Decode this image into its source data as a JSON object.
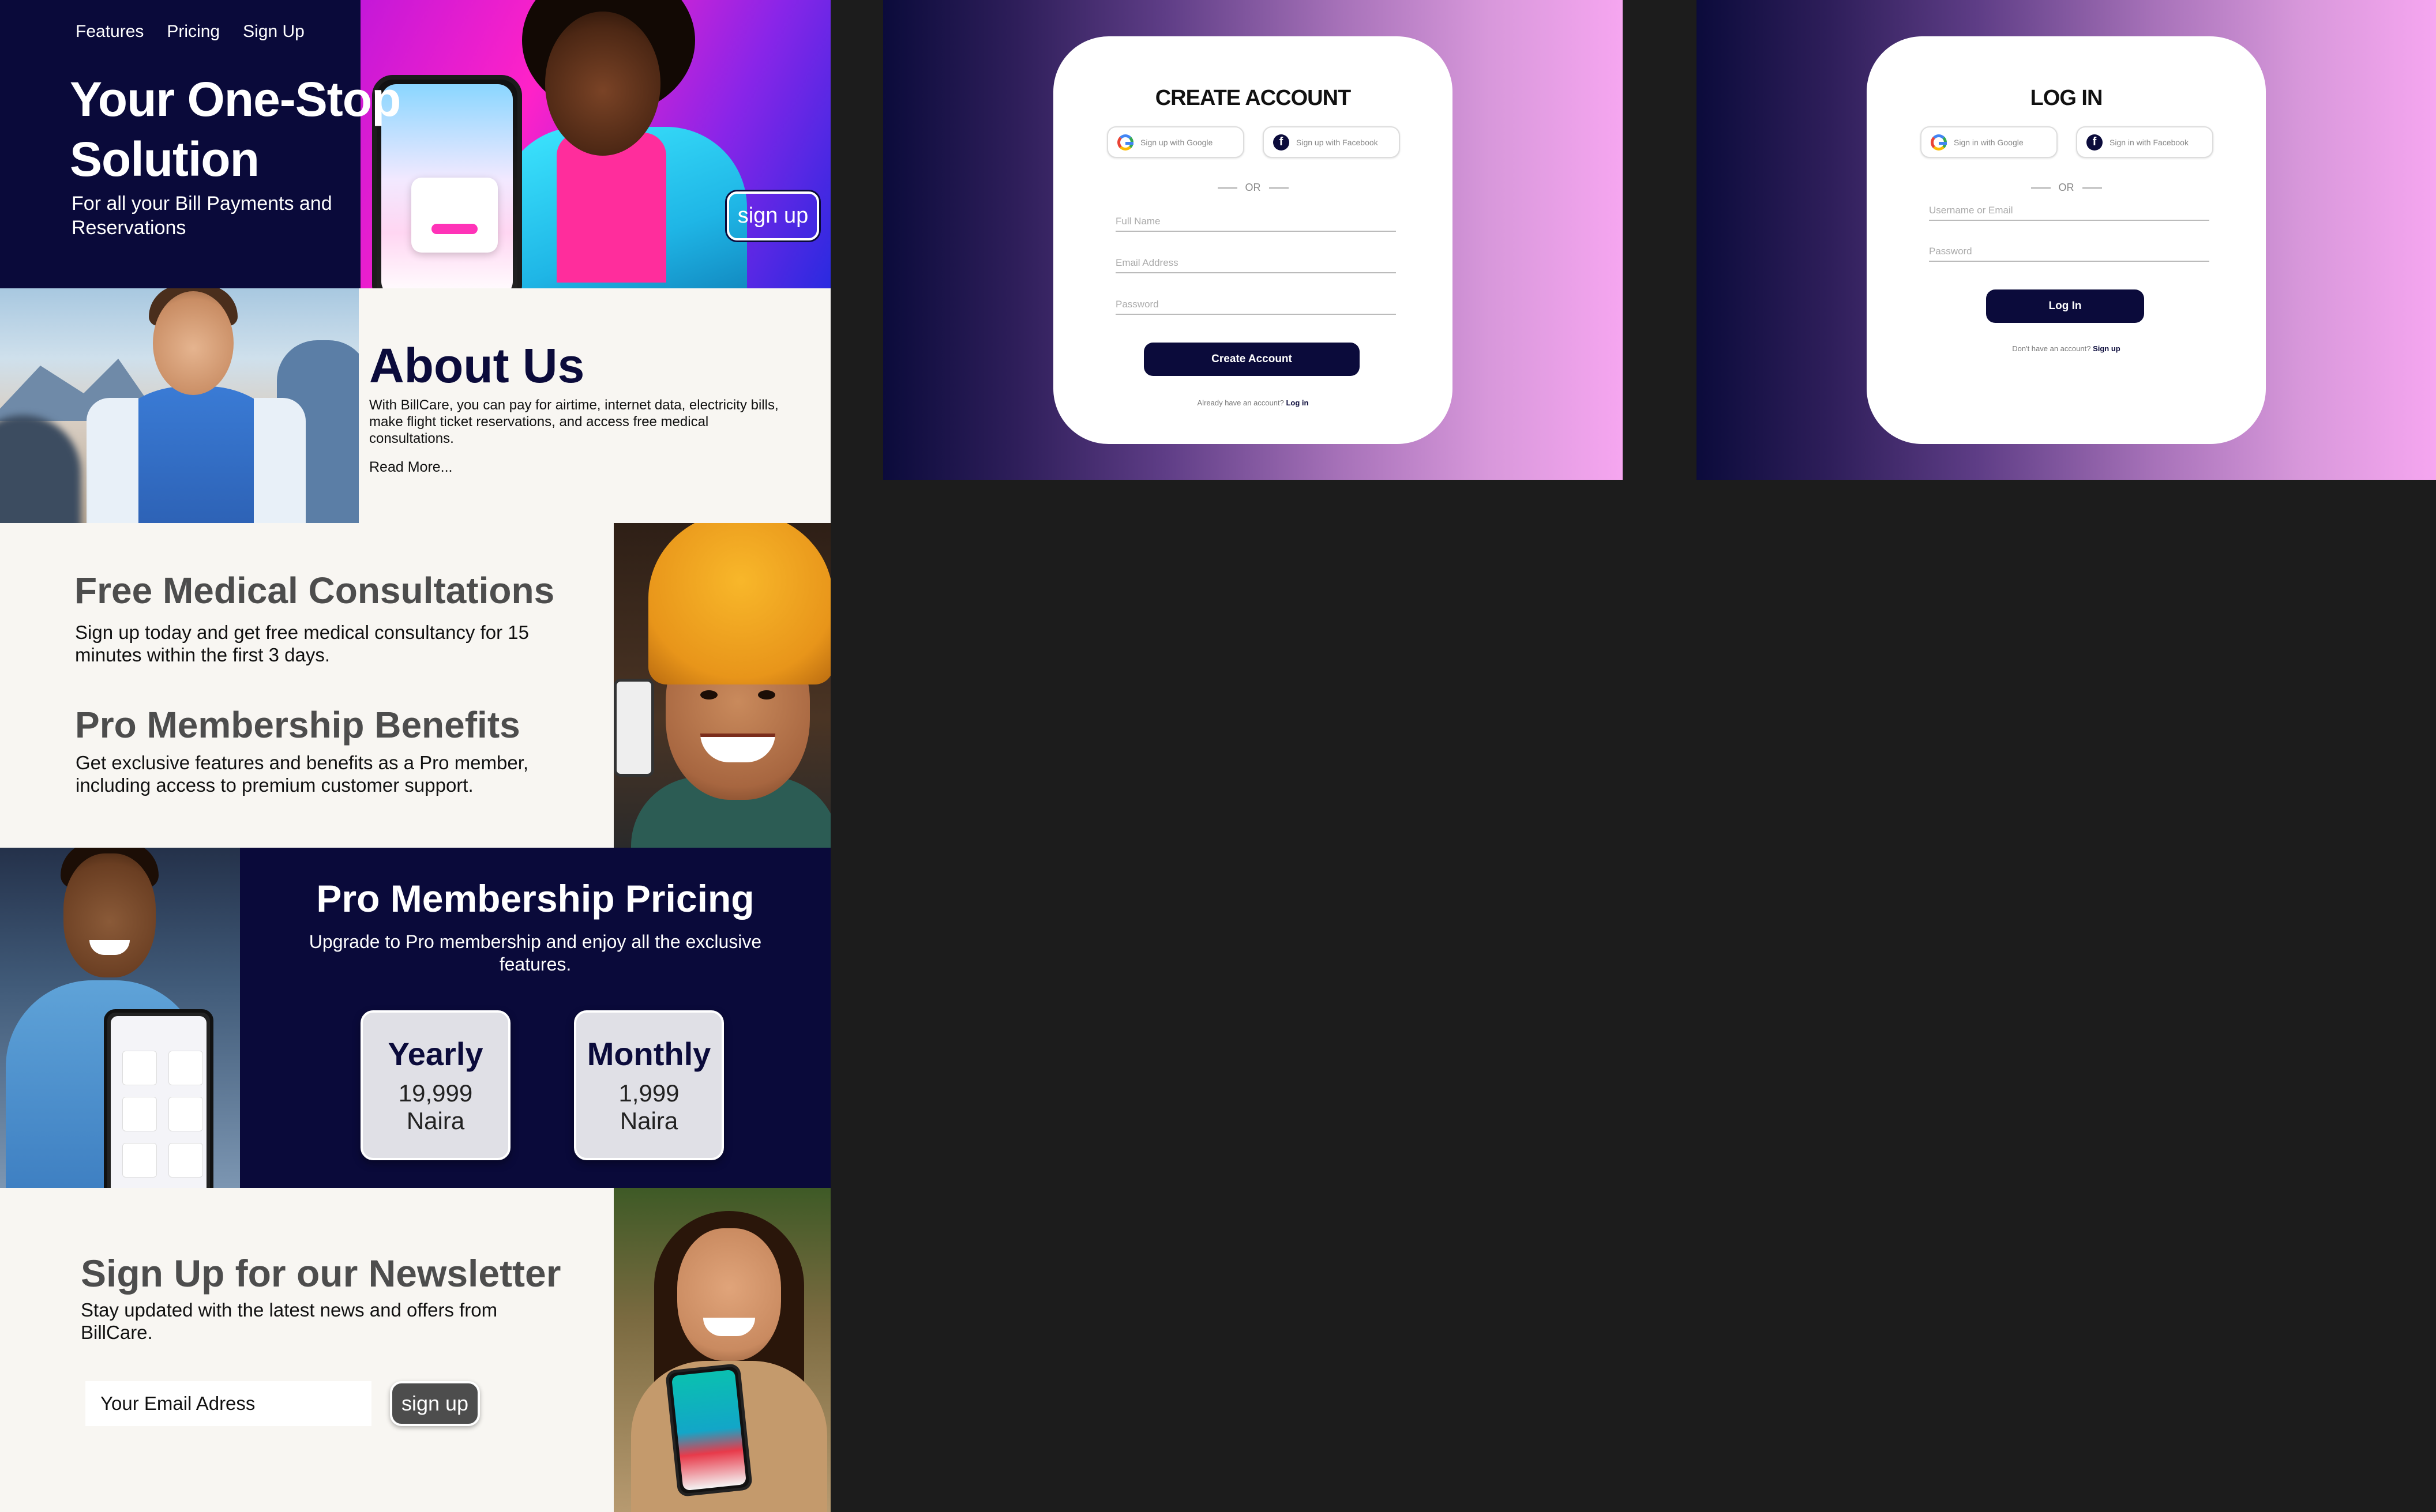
{
  "landing": {
    "nav": [
      "Features",
      "Pricing",
      "Sign Up"
    ],
    "hero": {
      "title": "Your One-Stop Solution",
      "subtitle": "For all your Bill Payments and Reservations",
      "cta": "sign up"
    },
    "about": {
      "title": "About Us",
      "text": "With BillCare, you can pay for airtime, internet data, electricity bills, make flight ticket reservations, and access free medical consultations.",
      "read_more": "Read More..."
    },
    "features": [
      {
        "title": "Free Medical Consultations",
        "text": "Sign up today and get free medical consultancy for 15 minutes within the first 3 days."
      },
      {
        "title": "Pro Membership Benefits",
        "text": "Get exclusive features and benefits as a Pro member, including access to premium customer support."
      }
    ],
    "pricing": {
      "title": "Pro Membership Pricing",
      "subtitle": "Upgrade to Pro membership and enjoy all the exclusive features.",
      "plans": [
        {
          "name": "Yearly",
          "price": "19,999",
          "currency": "Naira"
        },
        {
          "name": "Monthly",
          "price": "1,999",
          "currency": "Naira"
        }
      ]
    },
    "newsletter": {
      "title": "Sign Up for our Newsletter",
      "text": "Stay updated with the latest news and offers from BillCare.",
      "placeholder": "Your Email Adress",
      "cta": "sign up"
    }
  },
  "signup_screen": {
    "title": "CREATE ACCOUNT",
    "google_label": "Sign up with Google",
    "facebook_label": "Sign up with Facebook",
    "or": "OR",
    "fields": {
      "full_name": "Full Name",
      "email": "Email Address",
      "password": "Password"
    },
    "submit": "Create Account",
    "footer_text": "Already have an account?",
    "footer_link": "Log in"
  },
  "login_screen": {
    "title": "LOG IN",
    "google_label": "Sign in with Google",
    "facebook_label": "Sign in with Facebook",
    "or": "OR",
    "fields": {
      "username": "Username or Email",
      "password": "Password"
    },
    "submit": "Log In",
    "footer_text": "Don't have an account?",
    "footer_link": "Sign up"
  },
  "colors": {
    "navy": "#0b0b3b",
    "canvas": "#1c1c1c",
    "page_bg": "#f8f6f2",
    "heading_gray": "#4d4d4d",
    "card_gray": "#e0e0e6",
    "gradient_end": "#f6a6f0"
  },
  "icons": [
    "google-icon",
    "facebook-icon"
  ]
}
